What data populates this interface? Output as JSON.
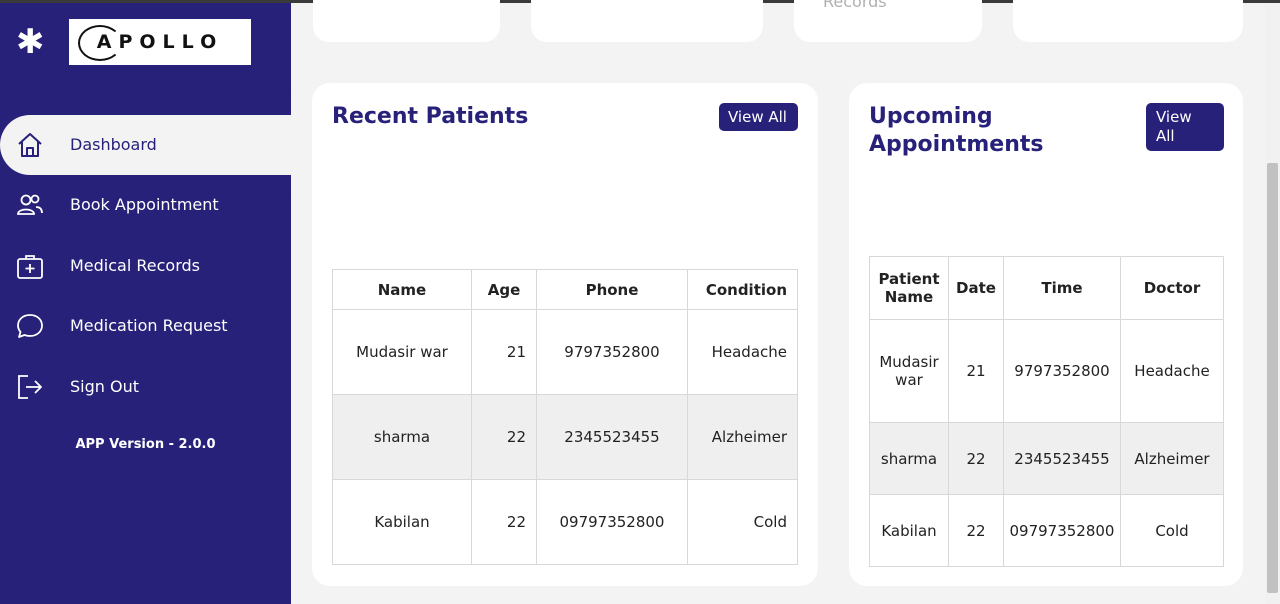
{
  "brand": {
    "logo_text": "APOLLO"
  },
  "sidebar": {
    "items": [
      {
        "label": "Dashboard",
        "icon": "home-icon"
      },
      {
        "label": "Book Appointment",
        "icon": "users-icon"
      },
      {
        "label": "Medical Records",
        "icon": "medical-kit-icon"
      },
      {
        "label": "Medication Request",
        "icon": "chat-icon"
      },
      {
        "label": "Sign Out",
        "icon": "sign-out-icon"
      }
    ],
    "version": "APP Version - 2.0.0"
  },
  "top_cards": {
    "records_peek": "Records"
  },
  "recent_patients": {
    "title": "Recent Patients",
    "view_all": "View All",
    "columns": [
      "Name",
      "Age",
      "Phone",
      "Condition"
    ],
    "rows": [
      [
        "Mudasir war",
        "21",
        "9797352800",
        "Headache"
      ],
      [
        "sharma",
        "22",
        "2345523455",
        "Alzheimer"
      ],
      [
        "Kabilan",
        "22",
        "09797352800",
        "Cold"
      ]
    ]
  },
  "upcoming": {
    "title": "Upcoming Appointments",
    "view_all": "View All",
    "columns": [
      "Patient Name",
      "Date",
      "Time",
      "Doctor"
    ],
    "rows": [
      [
        "Mudasir war",
        "21",
        "9797352800",
        "Headache"
      ],
      [
        "sharma",
        "22",
        "2345523455",
        "Alzheimer"
      ],
      [
        "Kabilan",
        "22",
        "09797352800",
        "Cold"
      ]
    ]
  },
  "colors": {
    "primary": "#27217a",
    "background": "#f3f3f3"
  }
}
